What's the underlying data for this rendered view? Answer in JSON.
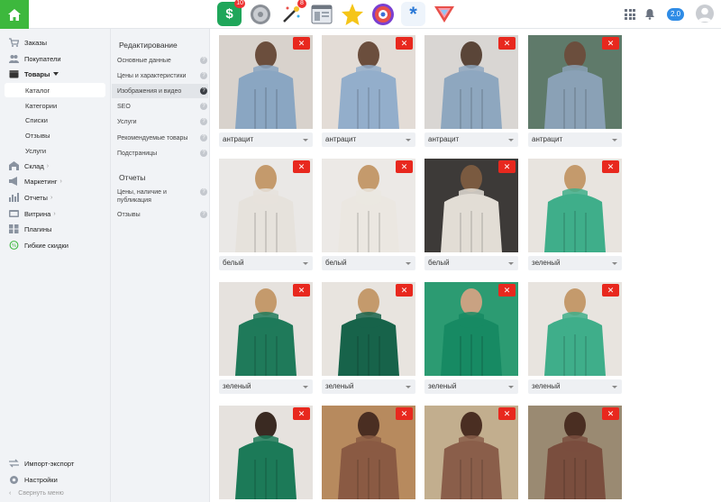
{
  "topbar": {
    "apps": [
      {
        "icon": "dollar-app-icon",
        "badge": "10"
      },
      {
        "icon": "gear-app-icon",
        "badge": ""
      },
      {
        "icon": "magic-wand-app-icon",
        "badge": "8"
      },
      {
        "icon": "window-app-icon",
        "badge": ""
      },
      {
        "icon": "star-app-icon",
        "badge": ""
      },
      {
        "icon": "target-app-icon",
        "badge": ""
      },
      {
        "icon": "asterisk-app-icon",
        "badge": ""
      },
      {
        "icon": "triangle-app-icon",
        "badge": ""
      }
    ],
    "version": "2.0"
  },
  "sidebar": {
    "items": [
      {
        "label": "Заказы",
        "icon": "cart-icon"
      },
      {
        "label": "Покупатели",
        "icon": "users-icon"
      },
      {
        "label": "Товары",
        "icon": "box-icon"
      },
      {
        "label": "Склад",
        "icon": "warehouse-icon"
      },
      {
        "label": "Маркетинг",
        "icon": "megaphone-icon"
      },
      {
        "label": "Отчеты",
        "icon": "chart-icon"
      },
      {
        "label": "Витрина",
        "icon": "storefront-icon"
      },
      {
        "label": "Плагины",
        "icon": "puzzle-icon"
      },
      {
        "label": "Гибкие скидки",
        "icon": "percent-icon"
      }
    ],
    "sub_items": [
      "Каталог",
      "Категории",
      "Списки",
      "Отзывы",
      "Услуги"
    ],
    "bottom": [
      {
        "label": "Импорт-экспорт",
        "icon": "exchange-icon"
      },
      {
        "label": "Настройки",
        "icon": "settings-icon"
      }
    ],
    "collapse_label": "Свернуть меню"
  },
  "editor": {
    "heading": "Редактирование",
    "items": [
      "Основные данные",
      "Цены и характеристики",
      "Изображения и видео",
      "SEO",
      "Услуги",
      "Рекомендуемые товары",
      "Подстраницы"
    ],
    "reports_heading": "Отчеты",
    "report_items": [
      "Цены, наличие и публикация",
      "Отзывы"
    ]
  },
  "photos": [
    {
      "color": "антрацит"
    },
    {
      "color": "антрацит"
    },
    {
      "color": "антрацит"
    },
    {
      "color": "антрацит"
    },
    {
      "color": "белый"
    },
    {
      "color": "белый"
    },
    {
      "color": "белый"
    },
    {
      "color": "зеленый"
    },
    {
      "color": "зеленый"
    },
    {
      "color": "зеленый"
    },
    {
      "color": "зеленый"
    },
    {
      "color": "зеленый"
    },
    {
      "color": ""
    },
    {
      "color": ""
    },
    {
      "color": ""
    },
    {
      "color": ""
    }
  ],
  "colors": {
    "accent_green": "#3db83d",
    "delete_red": "#e8281e",
    "badge_blue": "#2f8ce6"
  }
}
